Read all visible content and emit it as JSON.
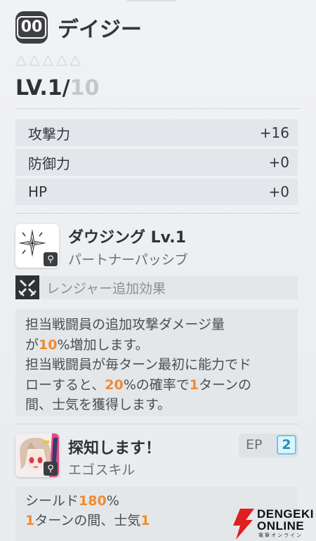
{
  "header": {
    "badge": "00",
    "name": "デイジー",
    "stars_empty": "△△△△△",
    "level_label": "LV.",
    "level_current": "1",
    "level_sep": "/",
    "level_max": "10"
  },
  "stats": [
    {
      "label": "攻撃力",
      "value": "+16"
    },
    {
      "label": "防御力",
      "value": "+0"
    },
    {
      "label": "HP",
      "value": "+0"
    }
  ],
  "skill": {
    "name": "ダウジング Lv.1",
    "type": "パートナーパッシブ",
    "ranger_label": "レンジャー追加効果",
    "desc_1": "担当戦闘員の追加攻撃ダメージ量",
    "desc_2a": "が",
    "desc_2b": "10",
    "desc_2c": "%増加します。",
    "desc_3": "担当戦闘員が毎ターン最初に能力でド",
    "desc_4a": "ローすると、",
    "desc_4b": "20",
    "desc_4c": "%の確率で",
    "desc_4d": "1",
    "desc_4e": "ターンの",
    "desc_5": "間、士気を獲得します。"
  },
  "ego": {
    "name": "探知します！",
    "type": "エゴスキル",
    "ep_label": "EP",
    "ep_value": "2",
    "desc_1a": "シールド",
    "desc_1b": "180",
    "desc_1c": "%",
    "desc_2a": "1",
    "desc_2b": "ターンの間、士気",
    "desc_2c": "1"
  },
  "watermark": {
    "line1": "DENGEKI",
    "line2": "ONLINE",
    "line3": "電撃オンライン"
  },
  "colors": {
    "highlight": "#f08a32",
    "ep_blue": "#1e8fc3",
    "watermark_red": "#e01f1f"
  }
}
